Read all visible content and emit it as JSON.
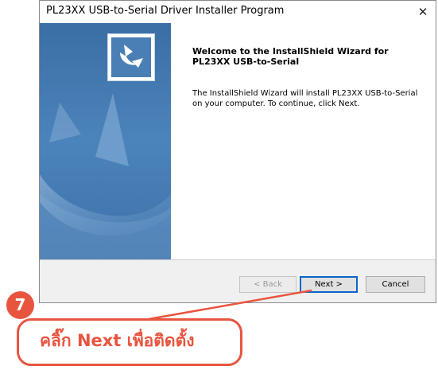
{
  "window": {
    "title": "PL23XX USB-to-Serial Driver Installer Program",
    "close_glyph": "✕"
  },
  "wizard": {
    "heading": "Welcome to the InstallShield Wizard for PL23XX USB-to-Serial",
    "body": "The InstallShield Wizard will install PL23XX USB-to-Serial on your computer.  To continue, click Next."
  },
  "buttons": {
    "back": "< Back",
    "next": "Next >",
    "cancel": "Cancel"
  },
  "annotation": {
    "step_number": "7",
    "callout_text": "คลิ๊ก Next เพื่อติดตั้ง"
  },
  "colors": {
    "accent": "#e8553f",
    "side_panel": "#3f76ab",
    "focus_border": "#0a64c8"
  },
  "icons": {
    "wizard_logo": "installshield-logo-icon",
    "close": "close-icon"
  }
}
